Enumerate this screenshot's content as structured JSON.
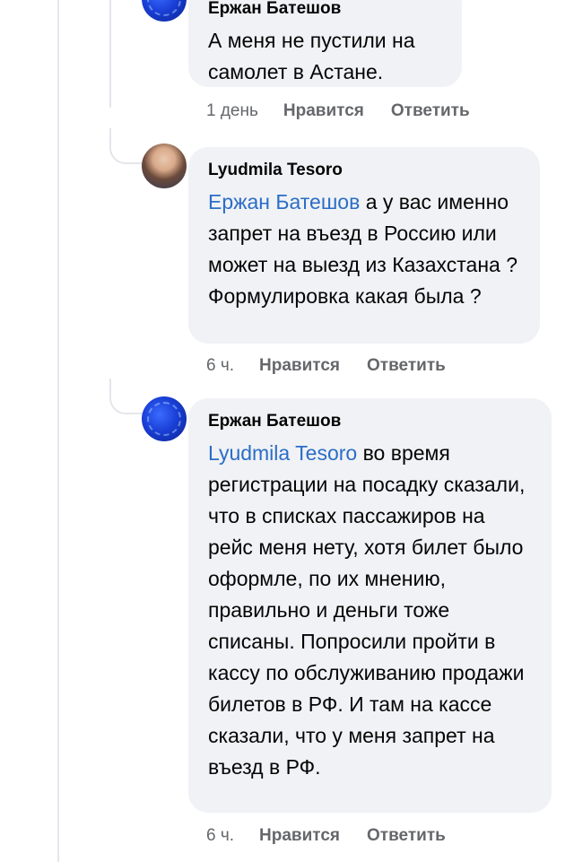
{
  "comments": [
    {
      "author": "Ержан Батешов",
      "mention": "",
      "text": "А меня не пустили на самолет в Астане.",
      "time": "1 день",
      "like_label": "Нравится",
      "reply_label": "Ответить",
      "avatar": "blue-abstract-avatar"
    },
    {
      "author": "Lyudmila Tesoro",
      "mention": "Ержан Батешов",
      "text": " а у вас именно запрет на въезд в Россию или может на выезд из Казахстана ? Формулировка какая была ?",
      "time": "6 ч.",
      "like_label": "Нравится",
      "reply_label": "Ответить",
      "avatar": "woman-photo-avatar"
    },
    {
      "author": "Ержан Батешов",
      "mention": "Lyudmila Tesoro",
      "text": " во время регистрации на посадку сказали, что в списках пассажиров на рейс меня нету, хотя билет было оформле, по их мнению, правильно и деньги тоже списаны. Попросили пройти в кассу по обслуживанию продажи билетов в РФ. И там на кассе сказали, что у меня запрет на въезд в РФ.",
      "time": "6 ч.",
      "like_label": "Нравится",
      "reply_label": "Ответить",
      "avatar": "blue-abstract-avatar"
    }
  ],
  "colors": {
    "bubble": "#f0f2f5",
    "mention": "#2b6dc7",
    "meta": "#65676b"
  }
}
